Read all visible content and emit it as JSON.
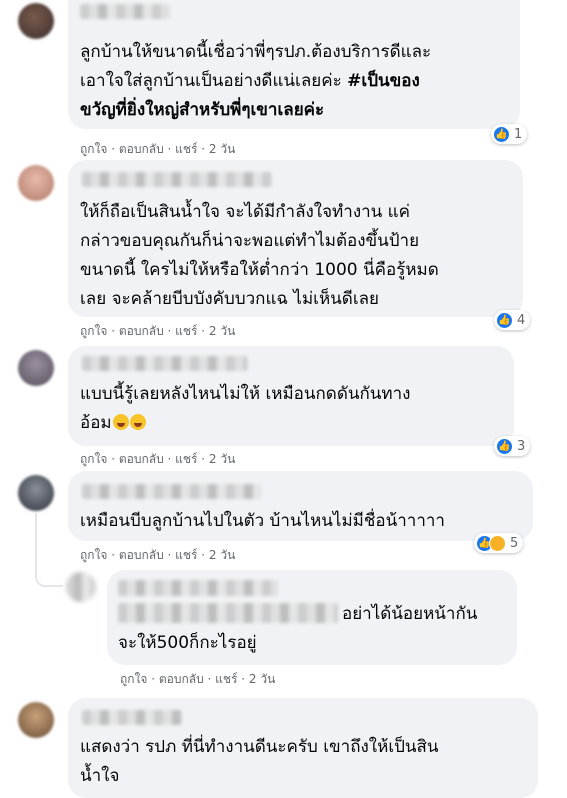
{
  "comments": [
    {
      "lines": [
        "ลูกบ้านให้ขนาดนี้เชื่อว่าพี่ๆรปภ.ต้องบริการดีและ",
        "เอาใจใส่ลูกบ้านเป็นอย่างดีแน่เลยค่ะ #เป็นของ",
        "ขวัญที่ยิ่งใหญ่สำหรับพี่ๆเขาเลยค่ะ"
      ],
      "actions": "ถูกใจ · ตอบกลับ · แชร์ · 2 วัน",
      "reaction_count": "1"
    },
    {
      "lines": [
        "ให้ก็ถือเป็นสินน้ำใจ จะได้มีกำลังใจทำงาน แค่",
        "กล่าวขอบคุณกันก็น่าจะพอแต่ทำไมต้องขึ้นป้าย",
        "ขนาดนี้ ใครไม่ให้หรือให้ต่ำกว่า 1000 นี่คือรู้หมด",
        "เลย จะคล้ายบีบบังคับบวกแฉ ไม่เห็นดีเลย"
      ],
      "actions": "ถูกใจ · ตอบกลับ · แชร์ · 2 วัน",
      "reaction_count": "4"
    },
    {
      "lines": [
        "แบบนี้รู้เลยหลังไหนไม่ให้ เหมือนกดดันกันทาง",
        "อ้อม"
      ],
      "actions": "ถูกใจ · ตอบกลับ · แชร์ · 2 วัน",
      "reaction_count": "3"
    },
    {
      "lines": [
        "เหมือนบีบลูกบ้านไปในตัว บ้านไหนไม่มีชื่อน้าาาาา"
      ],
      "actions": "ถูกใจ · ตอบกลับ · แชร์ · 2 วัน",
      "reaction_count": "5"
    },
    {
      "lines": [
        "อย่าได้น้อยหน้ากัน",
        "จะให้500ก็กะไรอยู่"
      ],
      "actions": "ถูกใจ · ตอบกลับ · แชร์ · 2 วัน"
    },
    {
      "lines": [
        "แสดงว่า รปภ ที่นี่ทำงานดีนะครับ เขาถึงให้เป็นสิน",
        "น้ำใจ"
      ]
    }
  ],
  "colors": {
    "bubble": "#f0f2f5",
    "like_blue": "#1877f2",
    "meta_gray": "#65676b"
  },
  "icons": [
    "like-icon",
    "haha-icon"
  ]
}
